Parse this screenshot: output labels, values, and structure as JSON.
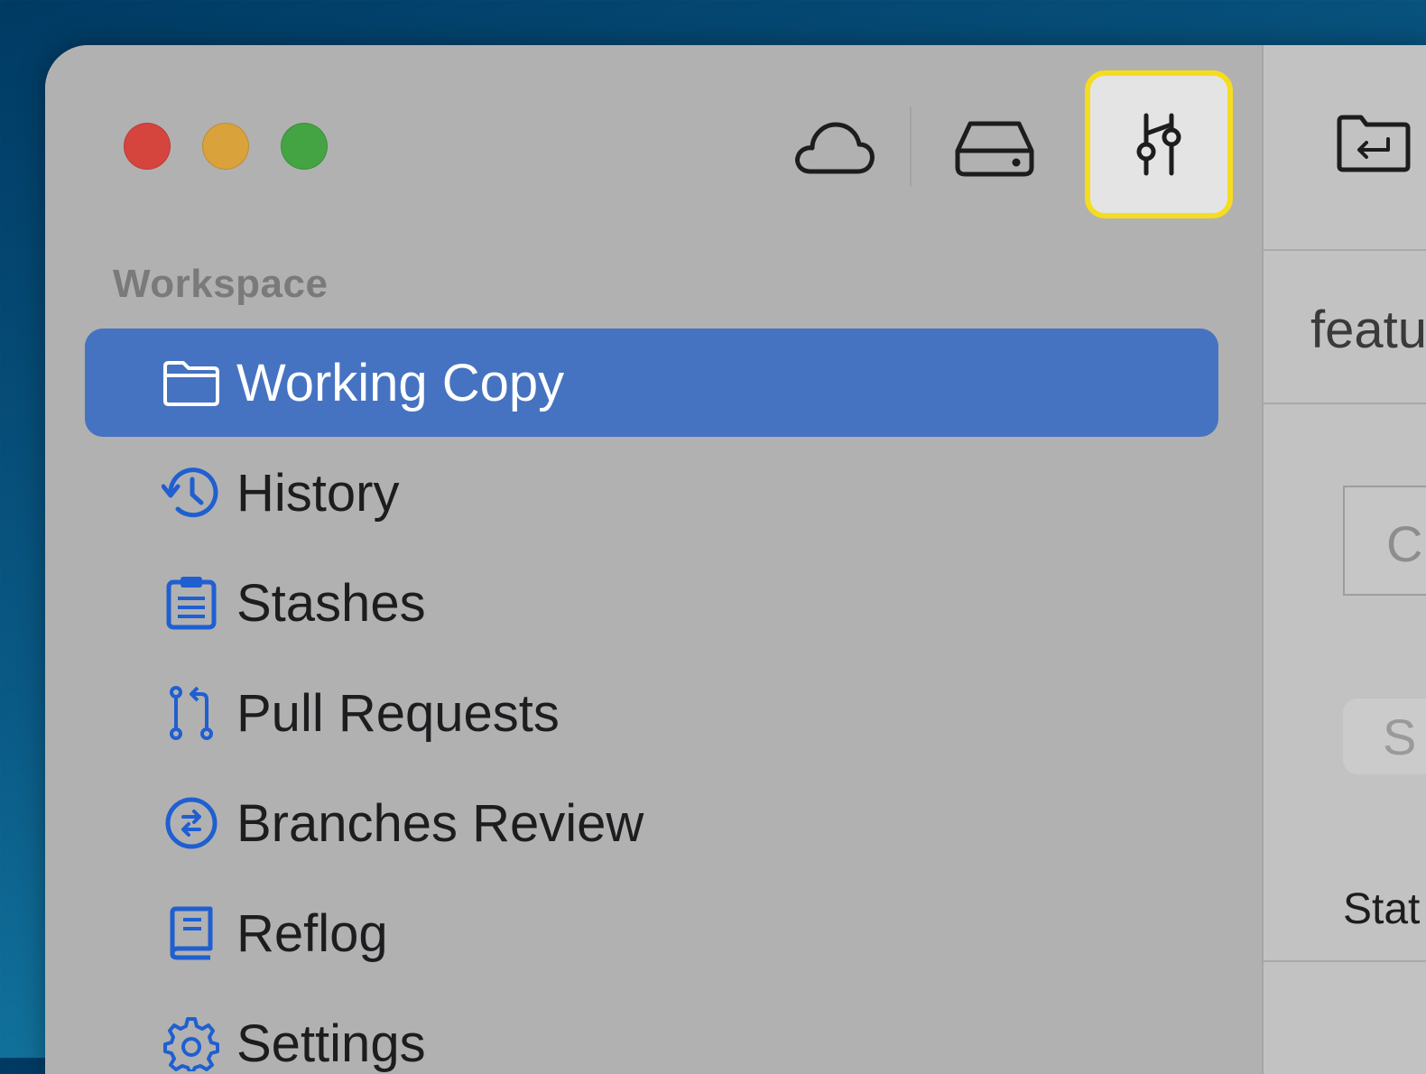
{
  "window": {
    "traffic_lights": [
      "close",
      "minimize",
      "zoom"
    ]
  },
  "toolbar": {
    "buttons": [
      {
        "name": "cloud-icon",
        "selected": false
      },
      {
        "name": "drive-icon",
        "selected": false
      },
      {
        "name": "sliders-icon",
        "selected": true
      }
    ]
  },
  "sidebar": {
    "section_label": "Workspace",
    "items": [
      {
        "label": "Working Copy",
        "icon": "folder-icon",
        "active": true
      },
      {
        "label": "History",
        "icon": "history-clock-icon",
        "active": false
      },
      {
        "label": "Stashes",
        "icon": "clipboard-icon",
        "active": false
      },
      {
        "label": "Pull Requests",
        "icon": "pull-request-icon",
        "active": false
      },
      {
        "label": "Branches Review",
        "icon": "branches-arrows-icon",
        "active": false
      },
      {
        "label": "Reflog",
        "icon": "book-icon",
        "active": false
      },
      {
        "label": "Settings",
        "icon": "gear-icon",
        "active": false
      }
    ]
  },
  "right_pane": {
    "branch_fragment": "featu",
    "box_fragment": "C",
    "pill_fragment": "S",
    "status_fragment": "Stat"
  },
  "colors": {
    "accent": "#4573c1",
    "icon_blue": "#1f5fd0",
    "highlight": "#f5dc1f"
  }
}
